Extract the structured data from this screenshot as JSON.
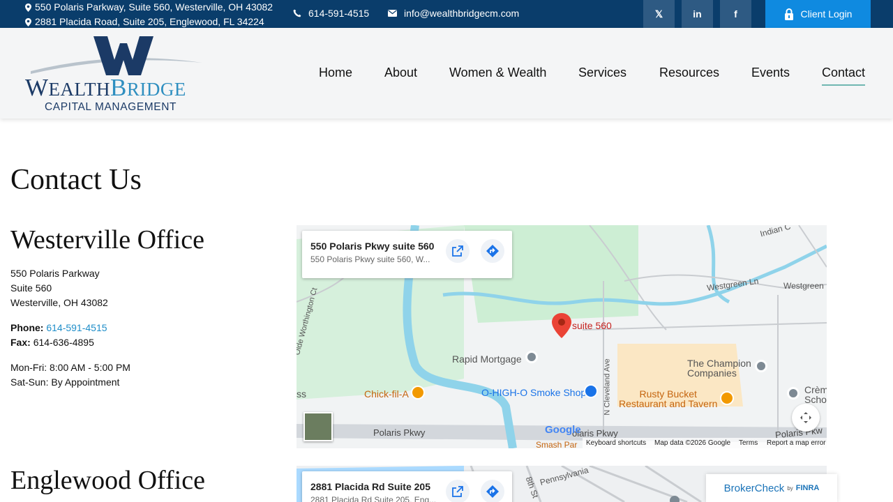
{
  "topbar": {
    "address_1": "550 Polaris Parkway, Suite 560, Westerville, OH 43082",
    "address_2": "2881 Placida Road, Suite 205, Englewood, FL 34224",
    "phone": "614-591-4515",
    "email": "info@wealthbridgecm.com",
    "social": [
      {
        "name": "x-icon",
        "glyph": "𝕏"
      },
      {
        "name": "linkedin-icon",
        "glyph": "in"
      },
      {
        "name": "facebook-icon",
        "glyph": "f"
      }
    ],
    "client_login": "Client Login"
  },
  "logo": {
    "line1": "WEALTHBRIDGE",
    "line2": "CAPITAL MANAGEMENT"
  },
  "nav": {
    "items": [
      "Home",
      "About",
      "Women & Wealth",
      "Services",
      "Resources",
      "Events",
      "Contact"
    ],
    "active": "Contact"
  },
  "page": {
    "title": "Contact Us"
  },
  "westerville": {
    "heading": "Westerville Office",
    "street": "550 Polaris Parkway",
    "suite": "Suite 560",
    "city": "Westerville, OH 43082",
    "phone_label": "Phone:",
    "phone": "614-591-4515",
    "fax_label": "Fax:",
    "fax": "614-636-4895",
    "hours_1": "Mon-Fri: 8:00 AM - 5:00 PM",
    "hours_2": "Sat-Sun: By Appointment",
    "map": {
      "card_title": "550 Polaris Pkwy suite 560",
      "card_subtitle": "550 Polaris Pkwy suite 560, W...",
      "pin_label": "suite 560",
      "places": {
        "rapid_mortgage": "Rapid Mortgage",
        "champion_1": "The Champion",
        "champion_2": "Companies",
        "chickfila": "Chick-fil-A",
        "smoke_shop": "O-HIGH-O Smoke Shop",
        "rusty_1": "Rusty Bucket",
        "rusty_2": "Restaurant and Tavern",
        "creme_1": "Crèm",
        "creme_2": "Scho",
        "ss": "ss",
        "smash": "Smash Par"
      },
      "roads": {
        "polaris_1": "Polaris Pkwy",
        "polaris_2": "olaris Pkwy",
        "polaris_3": "Polaris Pkw",
        "westgreen_1": "Westgreen Ln",
        "westgreen_2": "Westgreen",
        "indian": "Indian C",
        "olde": "Olde Worthington Ct",
        "cleveland": "N Cleveland Ave"
      },
      "google": "Google",
      "keyboard": "Keyboard shortcuts",
      "mapdata": "Map data ©2026 Google",
      "terms": "Terms",
      "report": "Report a map error"
    }
  },
  "englewood": {
    "heading": "Englewood Office",
    "map": {
      "card_title": "2881 Placida Rd Suite 205",
      "card_subtitle": "2881 Placida Rd Suite 205, Eng...",
      "road_1": "Pennsylvania",
      "road_2": "8th St"
    }
  },
  "brokercheck": {
    "brand": "BrokerCheck",
    "by": "by",
    "finra": "FINRA"
  },
  "colors": {
    "topbar": "#0a3d6b",
    "social_bg": "#2e5a83",
    "login": "#0f8ae0",
    "link": "#1f8ec9",
    "nav_underline": "#6fb7b1",
    "logo_navy": "#1b3a66",
    "logo_teal": "#2f8fc0"
  }
}
